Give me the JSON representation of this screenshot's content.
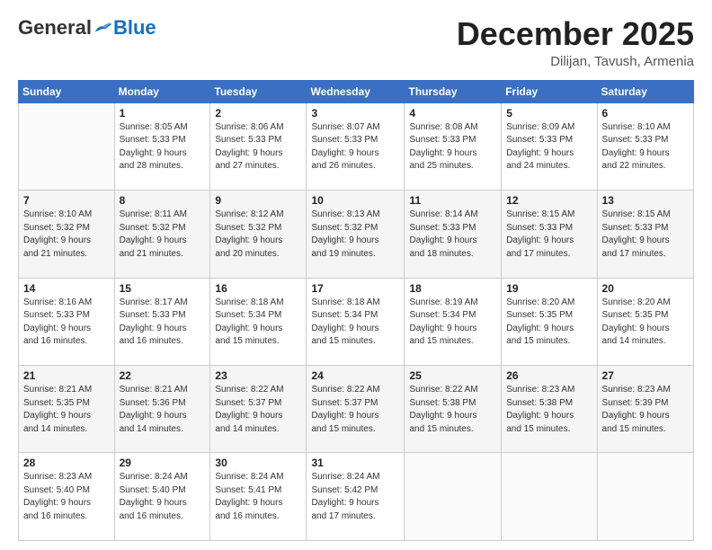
{
  "header": {
    "logo_general": "General",
    "logo_blue": "Blue",
    "month_year": "December 2025",
    "location": "Dilijan, Tavush, Armenia"
  },
  "weekdays": [
    "Sunday",
    "Monday",
    "Tuesday",
    "Wednesday",
    "Thursday",
    "Friday",
    "Saturday"
  ],
  "weeks": [
    [
      {
        "day": "",
        "info": ""
      },
      {
        "day": "1",
        "info": "Sunrise: 8:05 AM\nSunset: 5:33 PM\nDaylight: 9 hours\nand 28 minutes."
      },
      {
        "day": "2",
        "info": "Sunrise: 8:06 AM\nSunset: 5:33 PM\nDaylight: 9 hours\nand 27 minutes."
      },
      {
        "day": "3",
        "info": "Sunrise: 8:07 AM\nSunset: 5:33 PM\nDaylight: 9 hours\nand 26 minutes."
      },
      {
        "day": "4",
        "info": "Sunrise: 8:08 AM\nSunset: 5:33 PM\nDaylight: 9 hours\nand 25 minutes."
      },
      {
        "day": "5",
        "info": "Sunrise: 8:09 AM\nSunset: 5:33 PM\nDaylight: 9 hours\nand 24 minutes."
      },
      {
        "day": "6",
        "info": "Sunrise: 8:10 AM\nSunset: 5:33 PM\nDaylight: 9 hours\nand 22 minutes."
      }
    ],
    [
      {
        "day": "7",
        "info": "Sunrise: 8:10 AM\nSunset: 5:32 PM\nDaylight: 9 hours\nand 21 minutes."
      },
      {
        "day": "8",
        "info": "Sunrise: 8:11 AM\nSunset: 5:32 PM\nDaylight: 9 hours\nand 21 minutes."
      },
      {
        "day": "9",
        "info": "Sunrise: 8:12 AM\nSunset: 5:32 PM\nDaylight: 9 hours\nand 20 minutes."
      },
      {
        "day": "10",
        "info": "Sunrise: 8:13 AM\nSunset: 5:32 PM\nDaylight: 9 hours\nand 19 minutes."
      },
      {
        "day": "11",
        "info": "Sunrise: 8:14 AM\nSunset: 5:33 PM\nDaylight: 9 hours\nand 18 minutes."
      },
      {
        "day": "12",
        "info": "Sunrise: 8:15 AM\nSunset: 5:33 PM\nDaylight: 9 hours\nand 17 minutes."
      },
      {
        "day": "13",
        "info": "Sunrise: 8:15 AM\nSunset: 5:33 PM\nDaylight: 9 hours\nand 17 minutes."
      }
    ],
    [
      {
        "day": "14",
        "info": "Sunrise: 8:16 AM\nSunset: 5:33 PM\nDaylight: 9 hours\nand 16 minutes."
      },
      {
        "day": "15",
        "info": "Sunrise: 8:17 AM\nSunset: 5:33 PM\nDaylight: 9 hours\nand 16 minutes."
      },
      {
        "day": "16",
        "info": "Sunrise: 8:18 AM\nSunset: 5:34 PM\nDaylight: 9 hours\nand 15 minutes."
      },
      {
        "day": "17",
        "info": "Sunrise: 8:18 AM\nSunset: 5:34 PM\nDaylight: 9 hours\nand 15 minutes."
      },
      {
        "day": "18",
        "info": "Sunrise: 8:19 AM\nSunset: 5:34 PM\nDaylight: 9 hours\nand 15 minutes."
      },
      {
        "day": "19",
        "info": "Sunrise: 8:20 AM\nSunset: 5:35 PM\nDaylight: 9 hours\nand 15 minutes."
      },
      {
        "day": "20",
        "info": "Sunrise: 8:20 AM\nSunset: 5:35 PM\nDaylight: 9 hours\nand 14 minutes."
      }
    ],
    [
      {
        "day": "21",
        "info": "Sunrise: 8:21 AM\nSunset: 5:35 PM\nDaylight: 9 hours\nand 14 minutes."
      },
      {
        "day": "22",
        "info": "Sunrise: 8:21 AM\nSunset: 5:36 PM\nDaylight: 9 hours\nand 14 minutes."
      },
      {
        "day": "23",
        "info": "Sunrise: 8:22 AM\nSunset: 5:37 PM\nDaylight: 9 hours\nand 14 minutes."
      },
      {
        "day": "24",
        "info": "Sunrise: 8:22 AM\nSunset: 5:37 PM\nDaylight: 9 hours\nand 15 minutes."
      },
      {
        "day": "25",
        "info": "Sunrise: 8:22 AM\nSunset: 5:38 PM\nDaylight: 9 hours\nand 15 minutes."
      },
      {
        "day": "26",
        "info": "Sunrise: 8:23 AM\nSunset: 5:38 PM\nDaylight: 9 hours\nand 15 minutes."
      },
      {
        "day": "27",
        "info": "Sunrise: 8:23 AM\nSunset: 5:39 PM\nDaylight: 9 hours\nand 15 minutes."
      }
    ],
    [
      {
        "day": "28",
        "info": "Sunrise: 8:23 AM\nSunset: 5:40 PM\nDaylight: 9 hours\nand 16 minutes."
      },
      {
        "day": "29",
        "info": "Sunrise: 8:24 AM\nSunset: 5:40 PM\nDaylight: 9 hours\nand 16 minutes."
      },
      {
        "day": "30",
        "info": "Sunrise: 8:24 AM\nSunset: 5:41 PM\nDaylight: 9 hours\nand 16 minutes."
      },
      {
        "day": "31",
        "info": "Sunrise: 8:24 AM\nSunset: 5:42 PM\nDaylight: 9 hours\nand 17 minutes."
      },
      {
        "day": "",
        "info": ""
      },
      {
        "day": "",
        "info": ""
      },
      {
        "day": "",
        "info": ""
      }
    ]
  ]
}
